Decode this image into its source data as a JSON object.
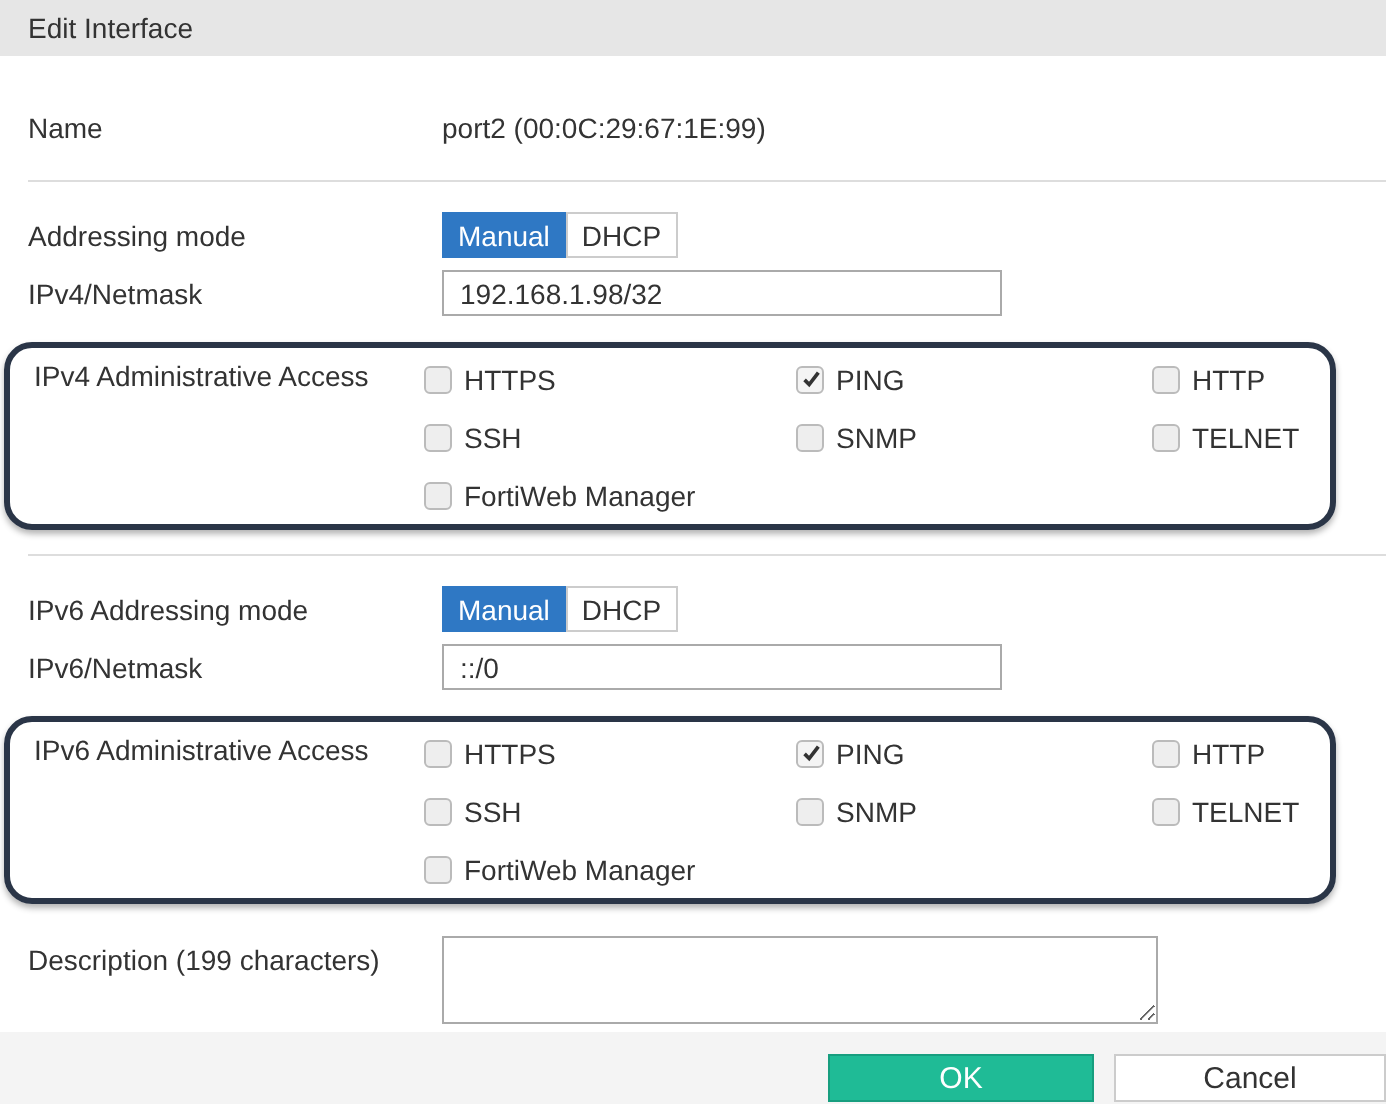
{
  "window": {
    "title": "Edit Interface"
  },
  "name": {
    "label": "Name",
    "value": "port2 (00:0C:29:67:1E:99)"
  },
  "ipv4": {
    "mode_label": "Addressing mode",
    "modes": [
      {
        "label": "Manual",
        "selected": true
      },
      {
        "label": "DHCP",
        "selected": false
      }
    ],
    "netmask_label": "IPv4/Netmask",
    "netmask": "192.168.1.98/32"
  },
  "ipv4_access": {
    "label": "IPv4 Administrative Access",
    "options": [
      {
        "label": "HTTPS",
        "checked": false
      },
      {
        "label": "PING",
        "checked": true
      },
      {
        "label": "HTTP",
        "checked": false
      },
      {
        "label": "SSH",
        "checked": false
      },
      {
        "label": "SNMP",
        "checked": false
      },
      {
        "label": "TELNET",
        "checked": false
      },
      {
        "label": "FortiWeb Manager",
        "checked": false
      }
    ]
  },
  "ipv6": {
    "mode_label": "IPv6 Addressing mode",
    "modes": [
      {
        "label": "Manual",
        "selected": true
      },
      {
        "label": "DHCP",
        "selected": false
      }
    ],
    "netmask_label": "IPv6/Netmask",
    "netmask": "::/0"
  },
  "ipv6_access": {
    "label": "IPv6 Administrative Access",
    "options": [
      {
        "label": "HTTPS",
        "checked": false
      },
      {
        "label": "PING",
        "checked": true
      },
      {
        "label": "HTTP",
        "checked": false
      },
      {
        "label": "SSH",
        "checked": false
      },
      {
        "label": "SNMP",
        "checked": false
      },
      {
        "label": "TELNET",
        "checked": false
      },
      {
        "label": "FortiWeb Manager",
        "checked": false
      }
    ]
  },
  "description": {
    "label": "Description (199 characters)"
  },
  "buttons": [
    {
      "label": "OK",
      "kind": "primary"
    },
    {
      "label": "Cancel",
      "kind": "secondary"
    }
  ]
}
